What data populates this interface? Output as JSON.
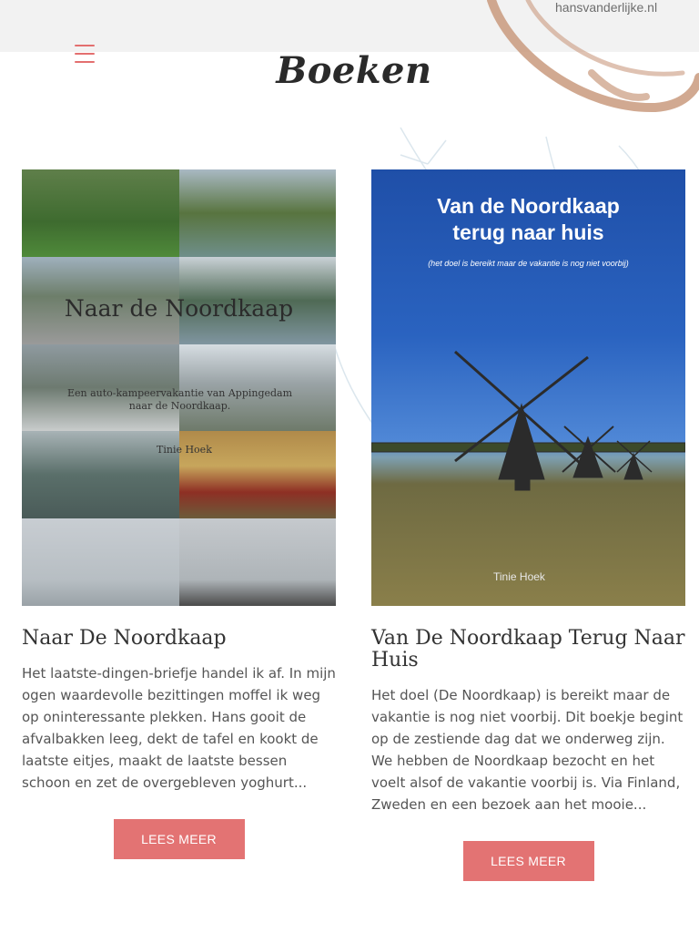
{
  "site": {
    "name": "hansvanderlijke.nl"
  },
  "page": {
    "title": "Boeken"
  },
  "colors": {
    "accent": "#e37373",
    "topbar": "#f2f2f2",
    "deco": "#c99a7e"
  },
  "icons": {
    "menu": "hamburger-icon"
  },
  "books": [
    {
      "title": "Naar De Noordkaap",
      "excerpt": "Het laatste-dingen-briefje handel ik af. In mijn ogen waardevolle bezittingen moffel ik weg op oninteressante plekken. Hans gooit de afvalbakken leeg, dekt de tafel en kookt de laatste eitjes, maakt de laatste bessen schoon en zet de overgebleven yoghurt...",
      "button": "LEES MEER",
      "cover": {
        "title": "Naar de Noordkaap",
        "subtitle": "Een auto-kampeervakantie van Appingedam naar de Noordkaap.",
        "author": "Tinie Hoek"
      }
    },
    {
      "title": "Van De Noordkaap Terug Naar Huis",
      "excerpt": "Het doel (De Noordkaap) is bereikt maar de vakantie is nog niet voorbij. Dit boekje begint op de zestiende dag dat we onderweg zijn. We hebben de Noordkaap bezocht en het voelt alsof de vakantie voorbij is. Via Finland, Zweden en een bezoek aan het mooie...",
      "button": "LEES MEER",
      "cover": {
        "title_line1": "Van de Noordkaap",
        "title_line2": "terug naar huis",
        "subtitle": "(het doel is bereikt maar de vakantie is nog niet voorbij)",
        "author": "Tinie Hoek"
      }
    }
  ]
}
